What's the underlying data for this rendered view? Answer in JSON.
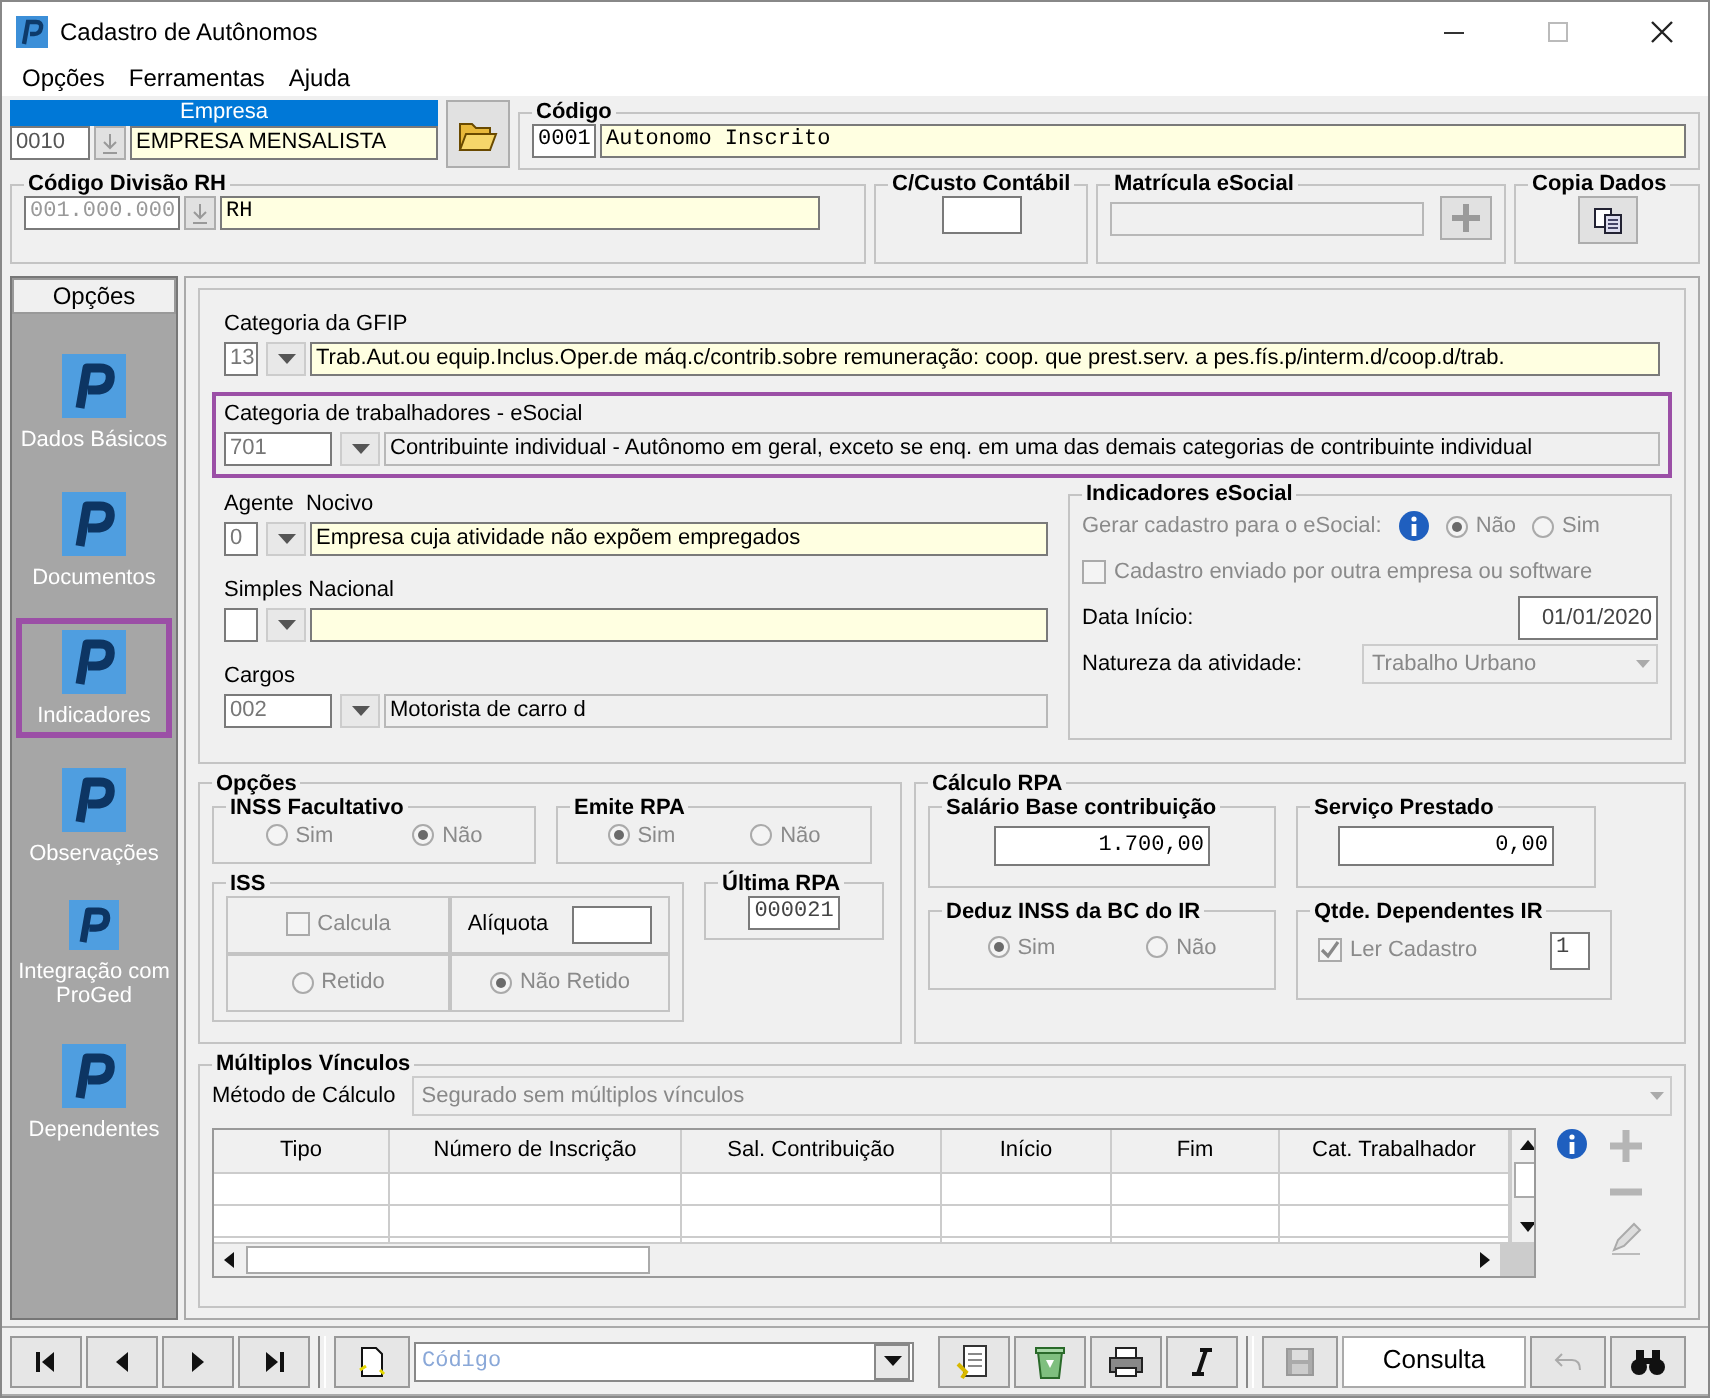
{
  "window": {
    "title": "Cadastro de Autônomos"
  },
  "menu": [
    {
      "label": "Opções"
    },
    {
      "label": "Ferramentas"
    },
    {
      "label": "Ajuda"
    }
  ],
  "empresa": {
    "label": "Empresa",
    "code": "0010",
    "name": "EMPRESA MENSALISTA"
  },
  "codigo": {
    "label": "Código",
    "code": "0001",
    "name": "Autonomo  Inscrito"
  },
  "divisao": {
    "label": "Código Divisão RH",
    "code": "001.000.000",
    "name": "RH"
  },
  "custo": {
    "label": "C/Custo Contábil"
  },
  "matricula": {
    "label": "Matrícula eSocial"
  },
  "copia": {
    "label": "Copia Dados"
  },
  "sidebar": {
    "title": "Opções",
    "items": [
      {
        "label": "Dados Básicos",
        "selected": false
      },
      {
        "label": "Documentos",
        "selected": false
      },
      {
        "label": "Indicadores",
        "selected": true
      },
      {
        "label": "Observações",
        "selected": false
      },
      {
        "label": "Integração com ProGed",
        "selected": false
      },
      {
        "label": "Dependentes",
        "selected": false
      }
    ]
  },
  "categorias": [
    {
      "label": "Categoria da GFIP",
      "code": "13",
      "text": "Trab.Aut.ou equip.Inclus.Oper.de máq.c/contrib.sobre remuneração: coop. que prest.serv. a pes.fís.p/interm.d/coop.d/trab.",
      "editable": true,
      "highlighted": false
    },
    {
      "label": "Categoria de trabalhadores - eSocial",
      "code": "701",
      "text": "Contribuinte individual - Autônomo em geral, exceto se enq. em uma das demais categorias de contribuinte individual",
      "editable": false,
      "highlighted": true
    }
  ],
  "outros": [
    {
      "label": "Agente  Nocivo",
      "code": "0",
      "text": "Empresa cuja atividade não expõem empregados",
      "editable": true
    },
    {
      "label": "Simples Nacional",
      "editable": true
    },
    {
      "label": "Cargos",
      "code": "002",
      "text": "Motorista de carro d",
      "editable": false
    }
  ],
  "indicadores": {
    "title": "Indicadores eSocial",
    "gerar_label": "Gerar cadastro para o eSocial:",
    "options": [
      {
        "label": "Não",
        "selected": true
      },
      {
        "label": "Sim",
        "selected": false
      }
    ],
    "enviado": {
      "label": "Cadastro enviado por outra empresa ou software",
      "checked": false
    },
    "data_label": "Data Início:",
    "data_value": "01/01/2020",
    "natureza_label": "Natureza da atividade:",
    "natureza_value": "Trabalho Urbano",
    "disabled": true
  },
  "opcoes": {
    "title": "Opções",
    "inss": {
      "title": "INSS Facultativo",
      "options": [
        {
          "label": "Sim",
          "selected": false
        },
        {
          "label": "Não",
          "selected": true
        }
      ]
    },
    "emite": {
      "title": "Emite RPA",
      "options": [
        {
          "label": "Sim",
          "selected": true
        },
        {
          "label": "Não",
          "selected": false
        }
      ]
    },
    "iss": {
      "title": "ISS",
      "calcula": {
        "label": "Calcula",
        "checked": false
      },
      "aliquota_label": "Alíquota",
      "options": [
        {
          "label": "Retido",
          "selected": false
        },
        {
          "label": "Não Retido",
          "selected": true
        }
      ]
    },
    "ultima": {
      "title": "Última RPA",
      "value": "000021"
    }
  },
  "calculo": {
    "title": "Cálculo RPA",
    "salario": {
      "title": "Salário Base contribuição",
      "value": "1.700,00"
    },
    "servico": {
      "title": "Serviço Prestado",
      "value": "0,00"
    },
    "deduz": {
      "title": "Deduz INSS da BC do IR",
      "options": [
        {
          "label": "Sim",
          "selected": true
        },
        {
          "label": "Não",
          "selected": false
        }
      ]
    },
    "dependentes": {
      "title": "Qtde. Dependentes IR",
      "ler": {
        "label": "Ler Cadastro",
        "checked": true
      },
      "value": "1"
    }
  },
  "multiplos": {
    "title": "Múltiplos Vínculos",
    "metodo_label": "Método de Cálculo",
    "metodo_value": "Segurado sem múltiplos vínculos",
    "columns": [
      "Tipo",
      "Número de Inscrição",
      "Sal. Contribuição",
      "Início",
      "Fim",
      "Cat. Trabalhador"
    ]
  },
  "toolbar": {
    "code_placeholder": "Código",
    "mode": "Consulta"
  }
}
